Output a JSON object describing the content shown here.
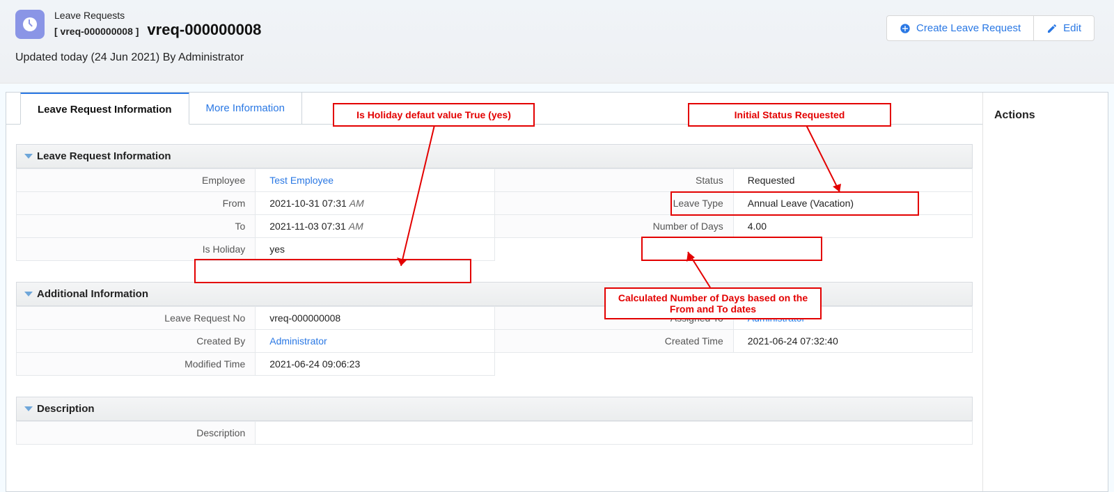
{
  "header": {
    "module": "Leave Requests",
    "record_id_bracket": "[ vreq-000000008 ]",
    "record_title": "vreq-000000008",
    "updated_line": "Updated today (24 Jun 2021) By Administrator",
    "create_btn": "Create Leave Request",
    "edit_btn": "Edit"
  },
  "tabs": {
    "active": "Leave Request Information",
    "other": "More Information"
  },
  "sections": {
    "main_title": "Leave Request Information",
    "fields_left": {
      "employee_lbl": "Employee",
      "employee_val": "Test Employee",
      "from_lbl": "From",
      "from_val": "2021-10-31 07:31",
      "from_ampm": "AM",
      "to_lbl": "To",
      "to_val": "2021-11-03 07:31",
      "to_ampm": "AM",
      "isholiday_lbl": "Is Holiday",
      "isholiday_val": "yes"
    },
    "fields_right": {
      "status_lbl": "Status",
      "status_val": "Requested",
      "leavetype_lbl": "Leave Type",
      "leavetype_val": "Annual Leave (Vacation)",
      "numdays_lbl": "Number of Days",
      "numdays_val": "4.00"
    },
    "addl_title": "Additional Information",
    "addl_left": {
      "reqno_lbl": "Leave Request No",
      "reqno_val": "vreq-000000008",
      "createdby_lbl": "Created By",
      "createdby_val": "Administrator",
      "modtime_lbl": "Modified Time",
      "modtime_val": "2021-06-24 09:06:23"
    },
    "addl_right": {
      "assignedto_lbl": "Assigned To",
      "assignedto_val": "Administrator",
      "createdtime_lbl": "Created Time",
      "createdtime_val": "2021-06-24 07:32:40"
    },
    "desc_title": "Description",
    "desc_lbl": "Description"
  },
  "side": {
    "actions_title": "Actions"
  },
  "annotations": {
    "holiday": "Is Holiday defaut value True (yes)",
    "status": "Initial Status Requested",
    "numdays": "Calculated Number of Days based on the From and To dates"
  }
}
